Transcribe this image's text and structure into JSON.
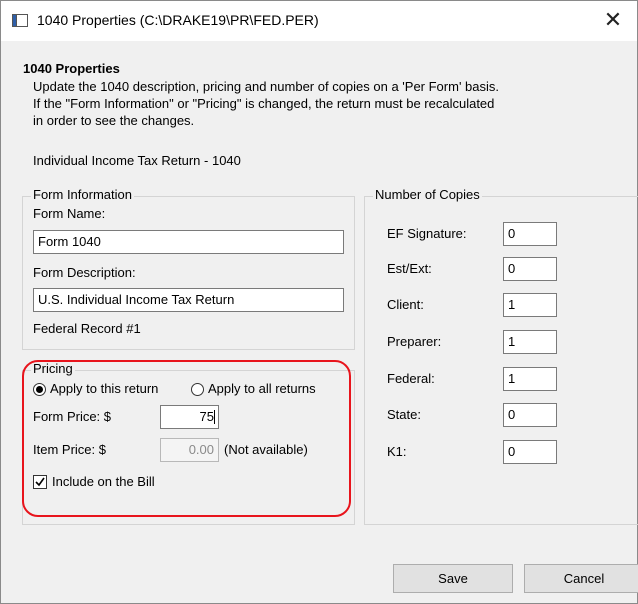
{
  "window": {
    "title": "1040 Properties (C:\\DRAKE19\\PR\\FED.PER)"
  },
  "header": {
    "title": "1040 Properties",
    "description_lines": [
      "Update the 1040 description, pricing and number of copies on a 'Per Form' basis.",
      "If the \"Form Information\" or \"Pricing\" is changed, the return must be recalculated",
      "in order to see the changes."
    ]
  },
  "form_type": "Individual Income Tax Return - 1040",
  "form_information": {
    "legend": "Form Information",
    "form_name_label": "Form Name:",
    "form_name_value": "Form 1040",
    "form_description_label": "Form Description:",
    "form_description_value": "U.S. Individual Income Tax Return",
    "record_text": "Federal Record #1"
  },
  "pricing": {
    "legend": "Pricing",
    "apply_this_label": "Apply to this return",
    "apply_all_label": "Apply to all returns",
    "apply_this_selected": true,
    "form_price_label": "Form Price: $",
    "form_price_value": "75",
    "item_price_label": "Item Price:  $",
    "item_price_value": "0.00",
    "item_price_note": "(Not available)",
    "include_on_bill_label": "Include on the Bill",
    "include_on_bill_checked": true
  },
  "copies": {
    "legend": "Number of Copies",
    "items": [
      {
        "label": "EF Signature:",
        "value": "0"
      },
      {
        "label": "Est/Ext:",
        "value": "0"
      },
      {
        "label": "Client:",
        "value": "1"
      },
      {
        "label": "Preparer:",
        "value": "1"
      },
      {
        "label": "Federal:",
        "value": "1"
      },
      {
        "label": "State:",
        "value": "0"
      },
      {
        "label": "K1:",
        "value": "0"
      }
    ]
  },
  "buttons": {
    "save": "Save",
    "cancel": "Cancel"
  },
  "colors": {
    "highlight": "#e8141c"
  },
  "icons": {
    "app": "window-app-icon",
    "close": "close-icon"
  }
}
